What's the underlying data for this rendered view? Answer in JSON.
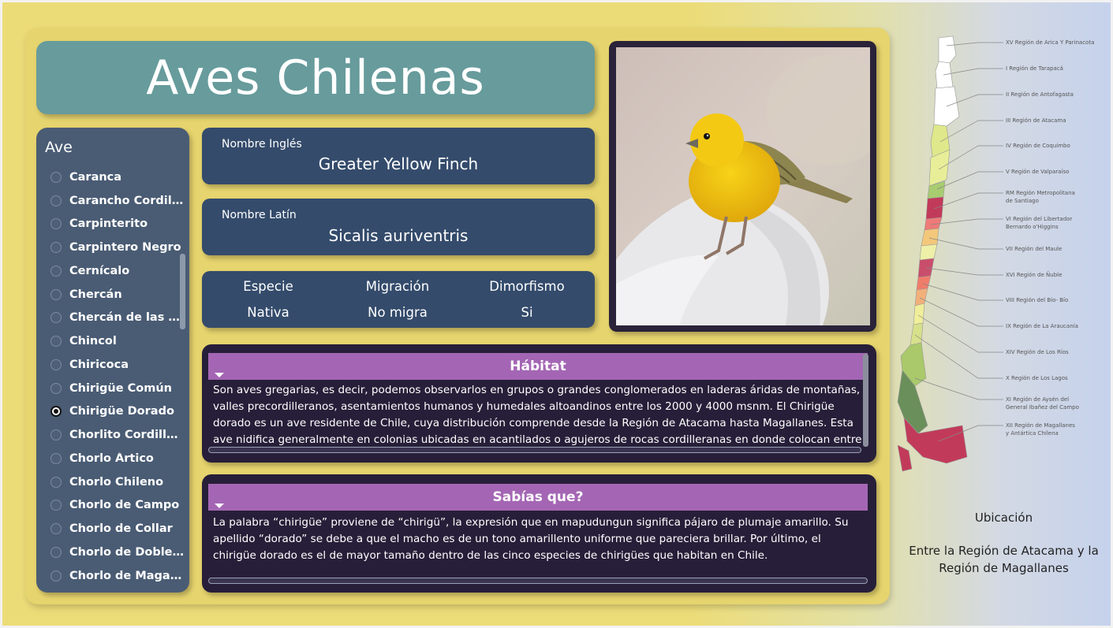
{
  "app": {
    "title": "Aves Chilenas"
  },
  "sidebar": {
    "title": "Ave",
    "selected": "Chirigüe Dorado",
    "items": [
      {
        "label": "Caranca",
        "checked": false
      },
      {
        "label": "Carancho Cordillerano",
        "checked": false
      },
      {
        "label": "Carpinterito",
        "checked": false
      },
      {
        "label": "Carpintero Negro",
        "checked": false
      },
      {
        "label": "Cernícalo",
        "checked": false
      },
      {
        "label": "Chercán",
        "checked": false
      },
      {
        "label": "Chercán de las Vegas",
        "checked": false
      },
      {
        "label": "Chincol",
        "checked": false
      },
      {
        "label": "Chiricoca",
        "checked": false
      },
      {
        "label": "Chirigüe Común",
        "checked": false
      },
      {
        "label": "Chirigüe Dorado",
        "checked": true
      },
      {
        "label": "Chorlito Cordillerano",
        "checked": false
      },
      {
        "label": "Chorlo Ártico",
        "checked": false
      },
      {
        "label": "Chorlo Chileno",
        "checked": false
      },
      {
        "label": "Chorlo de Campo",
        "checked": false
      },
      {
        "label": "Chorlo de Collar",
        "checked": false
      },
      {
        "label": "Chorlo de Doble Collar",
        "checked": false
      },
      {
        "label": "Chorlo de Magallanes",
        "checked": false
      }
    ]
  },
  "english_name": {
    "label": "Nombre Inglés",
    "value": "Greater Yellow Finch"
  },
  "latin_name": {
    "label": "Nombre Latín",
    "value": "Sicalis auriventris"
  },
  "attributes": {
    "especie_label": "Especie",
    "especie_value": "Nativa",
    "migracion_label": "Migración",
    "migracion_value": "No migra",
    "dimorfismo_label": "Dimorfismo",
    "dimorfismo_value": "Si"
  },
  "habitat": {
    "title": "Hábitat",
    "text": "Son aves gregarias, es decir, podemos observarlos en grupos o grandes conglomerados en laderas áridas de montañas, valles precordilleranos, asentamientos humanos y humedales altoandinos entre los 2000 y 4000 msnm. El Chirigüe dorado es un ave residente de Chile, cuya distribución comprende desde la Región de Atacama hasta Magallanes. Esta ave nidifica generalmente en colonias ubicadas en acantilados o agujeros de rocas cordilleranas en donde colocan entre dos a"
  },
  "trivia": {
    "title": "Sabías que?",
    "text": "La palabra “chirigüe” proviene de “chirigü”, la expresión que en mapudungun significa pájaro de plumaje amarillo. Su apellido “dorado” se debe a que el macho es de un tono amarillento uniforme que pareciera brillar.  Por último, el chirigüe dorado es el de mayor tamaño dentro de las cinco especies de chirigües que habitan en Chile."
  },
  "map": {
    "regions": [
      "XV Región de Arica Y Parinacota",
      "I Región de Tarapacá",
      "II Región de Antofagasta",
      "III Región de Atacama",
      "IV Región de Coquimbo",
      "V Región de Valparaíso",
      "RM Región Metropolitana",
      "de Santiago",
      "VI Región del Libertador",
      "Bernardo o'Higgins",
      "VII Región del Maule",
      "XVI Región de Ñuble",
      "VIII Región del Bío- Bío",
      "IX Región de La Araucanía",
      "XIV Región de Los Ríos",
      "X Región de Los Lagos",
      "XI Región de Aysén del",
      "General Ibañez del Campo",
      "XII Región de Magallanes",
      "y Antártica Chilena"
    ]
  },
  "location": {
    "title": "Ubicación",
    "text": "Entre la Región de Atacama y la Región de Magallanes"
  },
  "colors": {
    "background": "#ecdc78",
    "title_box": "#679b9c",
    "sidebar": "#4a5c74",
    "info_box": "#344b6b",
    "panel": "#271f39",
    "panel_header": "#a466b4",
    "bird_yellow": "#f2c010"
  }
}
